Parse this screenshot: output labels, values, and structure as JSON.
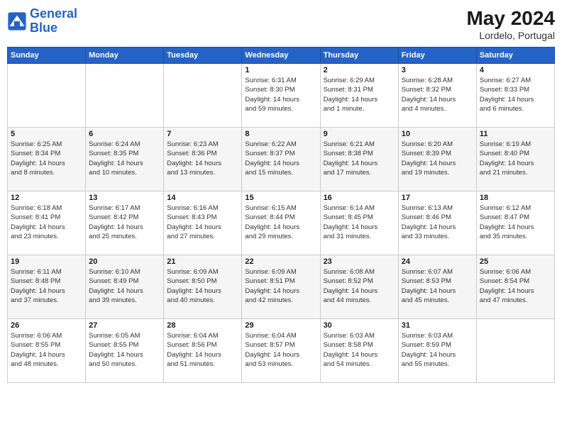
{
  "header": {
    "logo_line1": "General",
    "logo_line2": "Blue",
    "month": "May 2024",
    "location": "Lordelo, Portugal"
  },
  "days_of_week": [
    "Sunday",
    "Monday",
    "Tuesday",
    "Wednesday",
    "Thursday",
    "Friday",
    "Saturday"
  ],
  "weeks": [
    [
      {
        "day": "",
        "info": ""
      },
      {
        "day": "",
        "info": ""
      },
      {
        "day": "",
        "info": ""
      },
      {
        "day": "1",
        "info": "Sunrise: 6:31 AM\nSunset: 8:30 PM\nDaylight: 14 hours\nand 59 minutes."
      },
      {
        "day": "2",
        "info": "Sunrise: 6:29 AM\nSunset: 8:31 PM\nDaylight: 14 hours\nand 1 minute."
      },
      {
        "day": "3",
        "info": "Sunrise: 6:28 AM\nSunset: 8:32 PM\nDaylight: 14 hours\nand 4 minutes."
      },
      {
        "day": "4",
        "info": "Sunrise: 6:27 AM\nSunset: 8:33 PM\nDaylight: 14 hours\nand 6 minutes."
      }
    ],
    [
      {
        "day": "5",
        "info": "Sunrise: 6:25 AM\nSunset: 8:34 PM\nDaylight: 14 hours\nand 8 minutes."
      },
      {
        "day": "6",
        "info": "Sunrise: 6:24 AM\nSunset: 8:35 PM\nDaylight: 14 hours\nand 10 minutes."
      },
      {
        "day": "7",
        "info": "Sunrise: 6:23 AM\nSunset: 8:36 PM\nDaylight: 14 hours\nand 13 minutes."
      },
      {
        "day": "8",
        "info": "Sunrise: 6:22 AM\nSunset: 8:37 PM\nDaylight: 14 hours\nand 15 minutes."
      },
      {
        "day": "9",
        "info": "Sunrise: 6:21 AM\nSunset: 8:38 PM\nDaylight: 14 hours\nand 17 minutes."
      },
      {
        "day": "10",
        "info": "Sunrise: 6:20 AM\nSunset: 8:39 PM\nDaylight: 14 hours\nand 19 minutes."
      },
      {
        "day": "11",
        "info": "Sunrise: 6:19 AM\nSunset: 8:40 PM\nDaylight: 14 hours\nand 21 minutes."
      }
    ],
    [
      {
        "day": "12",
        "info": "Sunrise: 6:18 AM\nSunset: 8:41 PM\nDaylight: 14 hours\nand 23 minutes."
      },
      {
        "day": "13",
        "info": "Sunrise: 6:17 AM\nSunset: 8:42 PM\nDaylight: 14 hours\nand 25 minutes."
      },
      {
        "day": "14",
        "info": "Sunrise: 6:16 AM\nSunset: 8:43 PM\nDaylight: 14 hours\nand 27 minutes."
      },
      {
        "day": "15",
        "info": "Sunrise: 6:15 AM\nSunset: 8:44 PM\nDaylight: 14 hours\nand 29 minutes."
      },
      {
        "day": "16",
        "info": "Sunrise: 6:14 AM\nSunset: 8:45 PM\nDaylight: 14 hours\nand 31 minutes."
      },
      {
        "day": "17",
        "info": "Sunrise: 6:13 AM\nSunset: 8:46 PM\nDaylight: 14 hours\nand 33 minutes."
      },
      {
        "day": "18",
        "info": "Sunrise: 6:12 AM\nSunset: 8:47 PM\nDaylight: 14 hours\nand 35 minutes."
      }
    ],
    [
      {
        "day": "19",
        "info": "Sunrise: 6:11 AM\nSunset: 8:48 PM\nDaylight: 14 hours\nand 37 minutes."
      },
      {
        "day": "20",
        "info": "Sunrise: 6:10 AM\nSunset: 8:49 PM\nDaylight: 14 hours\nand 39 minutes."
      },
      {
        "day": "21",
        "info": "Sunrise: 6:09 AM\nSunset: 8:50 PM\nDaylight: 14 hours\nand 40 minutes."
      },
      {
        "day": "22",
        "info": "Sunrise: 6:09 AM\nSunset: 8:51 PM\nDaylight: 14 hours\nand 42 minutes."
      },
      {
        "day": "23",
        "info": "Sunrise: 6:08 AM\nSunset: 8:52 PM\nDaylight: 14 hours\nand 44 minutes."
      },
      {
        "day": "24",
        "info": "Sunrise: 6:07 AM\nSunset: 8:53 PM\nDaylight: 14 hours\nand 45 minutes."
      },
      {
        "day": "25",
        "info": "Sunrise: 6:06 AM\nSunset: 8:54 PM\nDaylight: 14 hours\nand 47 minutes."
      }
    ],
    [
      {
        "day": "26",
        "info": "Sunrise: 6:06 AM\nSunset: 8:55 PM\nDaylight: 14 hours\nand 48 minutes."
      },
      {
        "day": "27",
        "info": "Sunrise: 6:05 AM\nSunset: 8:55 PM\nDaylight: 14 hours\nand 50 minutes."
      },
      {
        "day": "28",
        "info": "Sunrise: 6:04 AM\nSunset: 8:56 PM\nDaylight: 14 hours\nand 51 minutes."
      },
      {
        "day": "29",
        "info": "Sunrise: 6:04 AM\nSunset: 8:57 PM\nDaylight: 14 hours\nand 53 minutes."
      },
      {
        "day": "30",
        "info": "Sunrise: 6:03 AM\nSunset: 8:58 PM\nDaylight: 14 hours\nand 54 minutes."
      },
      {
        "day": "31",
        "info": "Sunrise: 6:03 AM\nSunset: 8:59 PM\nDaylight: 14 hours\nand 55 minutes."
      },
      {
        "day": "",
        "info": ""
      }
    ]
  ]
}
